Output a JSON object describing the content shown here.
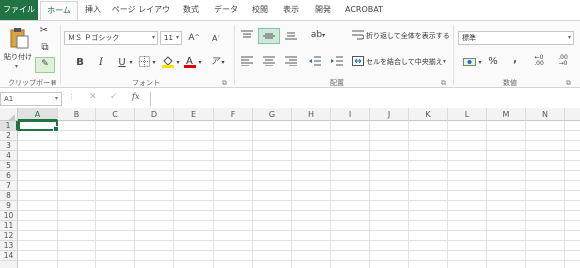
{
  "tabs": [
    "ファイル",
    "ホーム",
    "挿入",
    "ページ レイアウト",
    "数式",
    "データ",
    "校閲",
    "表示",
    "開発",
    "ACROBAT"
  ],
  "clipboard": {
    "paste_label": "貼り付け",
    "group_label": "クリップボード"
  },
  "font": {
    "name_value": "ＭＳ Ｐゴシック",
    "size_value": "11",
    "group_label": "フォント",
    "fill_color": "#ffe600",
    "font_color": "#e00000"
  },
  "alignment": {
    "wrap_label": "折り返して全体を表示する",
    "merge_label": "セルを結合して中央揃え",
    "group_label": "配置"
  },
  "number": {
    "format_value": "標準",
    "percent_symbol": "%",
    "comma_symbol": ",",
    "group_label": "数値"
  },
  "formula_bar": {
    "name_box": "A1",
    "fx": "fx"
  },
  "columns": [
    "A",
    "B",
    "C",
    "D",
    "E",
    "F",
    "G",
    "H",
    "I",
    "J",
    "K",
    "L",
    "M",
    "N"
  ],
  "rows": [
    "1",
    "2",
    "3",
    "4",
    "5",
    "6",
    "7",
    "8",
    "9",
    "10",
    "11",
    "12",
    "13",
    "14"
  ]
}
